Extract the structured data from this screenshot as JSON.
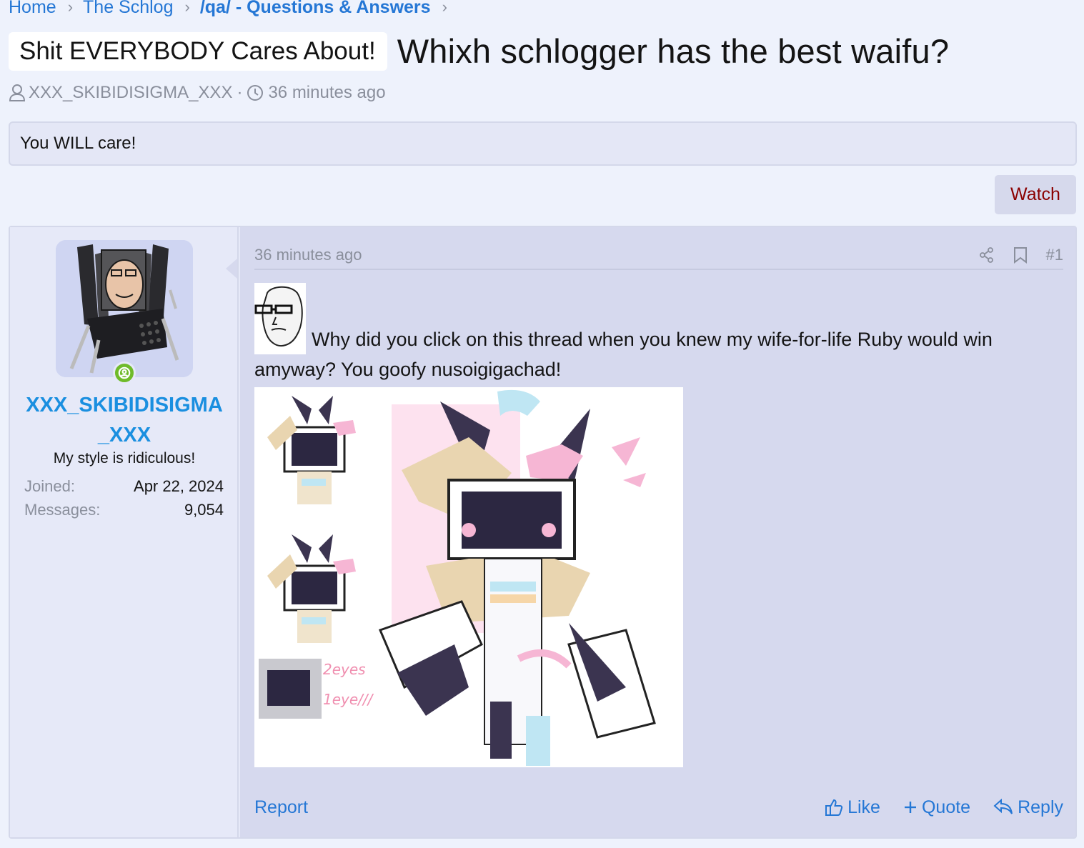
{
  "breadcrumb": {
    "items": [
      {
        "label": "Home"
      },
      {
        "label": "The Schlog"
      },
      {
        "label": "/qa/ - Questions & Answers"
      }
    ]
  },
  "thread": {
    "prefix": "Shit EVERYBODY Cares About!",
    "title": "Whixh schlogger has the best waifu?",
    "author": "XXX_SKIBIDISIGMA_XXX",
    "separator": "·",
    "time": "36 minutes ago",
    "description": "You WILL care!",
    "watch_label": "Watch"
  },
  "post": {
    "user": {
      "username": "XXX_SKIBIDISIGMA_XXX",
      "title": "My style is ridiculous!",
      "joined_label": "Joined:",
      "joined_value": "Apr 22, 2024",
      "messages_label": "Messages:",
      "messages_value": "9,054"
    },
    "time": "36 minutes ago",
    "number": "#1",
    "body": "Why did you click on this thread when you knew my wife-for-life Ruby would win amyway? You goofy nusoigigachad!",
    "image_texts": {
      "line1": "2eyes",
      "line2": "1eye///"
    },
    "actions": {
      "report": "Report",
      "like": "Like",
      "quote": "Quote",
      "reply": "Reply"
    }
  },
  "colors": {
    "link": "#2577d5",
    "username": "#1a8fe0",
    "watch_text": "#8b0000",
    "online": "#6fbb2a",
    "background": "#eef2fc"
  }
}
